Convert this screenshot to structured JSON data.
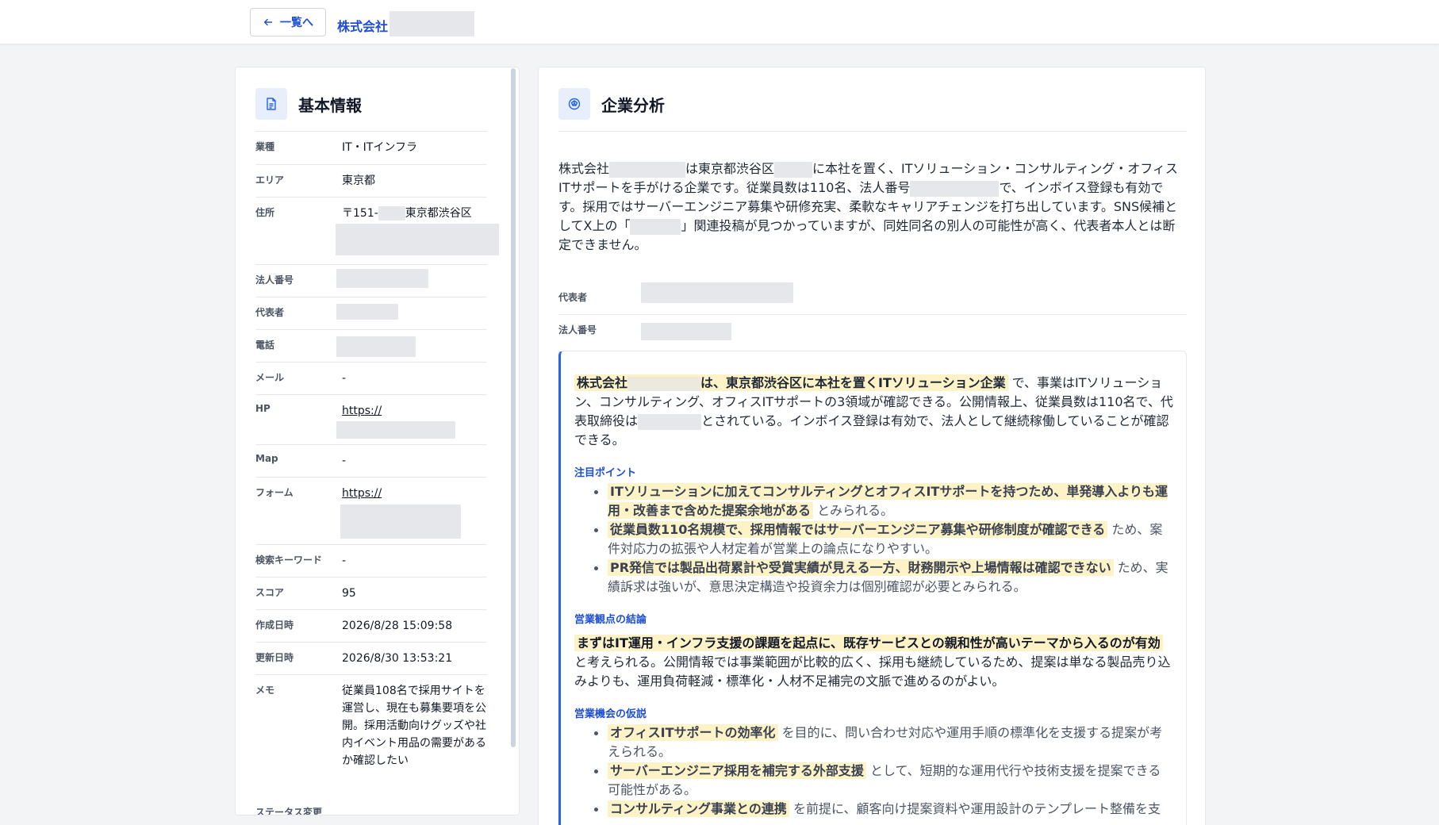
{
  "header": {
    "back_label": "一覧へ",
    "company_title": "株式会社"
  },
  "left": {
    "title": "基本情報",
    "rows": [
      {
        "label": "業種",
        "value": "IT・ITインフラ"
      },
      {
        "label": "エリア",
        "value": "東京都"
      },
      {
        "label": "住所",
        "value_prefix": "〒151-",
        "value_suffix": "東京都渋谷区"
      },
      {
        "label": "法人番号"
      },
      {
        "label": "代表者"
      },
      {
        "label": "電話"
      },
      {
        "label": "メール",
        "value": "-"
      },
      {
        "label": "HP",
        "value": "https://"
      },
      {
        "label": "Map",
        "value": "-"
      },
      {
        "label": "フォーム",
        "value": "https://"
      },
      {
        "label": "検索キーワード",
        "value": "-"
      },
      {
        "label": "スコア",
        "value": "95"
      },
      {
        "label": "作成日時",
        "value": "2026/8/28 15:09:58"
      },
      {
        "label": "更新日時",
        "value": "2026/8/30 13:53:21"
      },
      {
        "label": "メモ",
        "value": "従業員108名で採用サイトを運営し、現在も募集要項を公開。採用活動向けグッズや社内イベント用品の需要があるか確認したい"
      },
      {
        "label": "ステータス変更"
      }
    ]
  },
  "right": {
    "title": "企業分析",
    "summary": {
      "p1": "株式会社",
      "p2": "は東京都渋谷区",
      "p3": "に本社を置く、ITソリューション・コンサルティング・オフィスITサポートを手がける企業です。従業員数は110名、法人番号",
      "p4": "で、インボイス登録も有効です。採用ではサーバーエンジニア募集や研修充実、柔軟なキャリアチェンジを打ち出しています。SNS候補としてX上の「",
      "p5": "」関連投稿が見つかっていますが、同姓同名の別人の可能性が高く、代表者本人とは断定できません。"
    },
    "meta": [
      {
        "label": "代表者"
      },
      {
        "label": "法人番号"
      }
    ],
    "analysis": {
      "intro_hl_a": "株式会社",
      "intro_hl_b": "は、東京都渋谷区に本社を置くITソリューション企業",
      "intro_rest_a": "で、事業はITソリューション、コンサルティング、オフィスITサポートの3領域が確認できる。公開情報上、従業員数は110名で、代表取締役は",
      "intro_rest_b": "とされている。インボイス登録は有効で、法人として継続稼働していることが確認できる。",
      "points_title": "注目ポイント",
      "points": [
        {
          "hl": "ITソリューションに加えてコンサルティングとオフィスITサポートを持つため、単発導入よりも運用・改善まで含めた提案余地がある",
          "rest": "とみられる。"
        },
        {
          "hl": "従業員数110名規模で、採用情報ではサーバーエンジニア募集や研修制度が確認できる",
          "rest": "ため、案件対応力の拡張や人材定着が営業上の論点になりやすい。"
        },
        {
          "hl": "PR発信では製品出荷累計や受賞実績が見える一方、財務開示や上場情報は確認できない",
          "rest": "ため、実績訴求は強いが、意思決定構造や投資余力は個別確認が必要とみられる。"
        }
      ],
      "conclusion_title": "営業観点の結論",
      "conclusion_hl": "まずはIT運用・インフラ支援の課題を起点に、既存サービスとの親和性が高いテーマから入るのが有効",
      "conclusion_rest": "と考えられる。公開情報では事業範囲が比較的広く、採用も継続しているため、提案は単なる製品売り込みよりも、運用負荷軽減・標準化・人材不足補完の文脈で進めるのがよい。",
      "chances_title": "営業機会の仮説",
      "chances": [
        {
          "hl": "オフィスITサポートの効率化",
          "rest": "を目的に、問い合わせ対応や運用手順の標準化を支援する提案が考えられる。"
        },
        {
          "hl": "サーバーエンジニア採用を補完する外部支援",
          "rest": "として、短期的な運用代行や技術支援を提案できる可能性がある。"
        },
        {
          "hl": "コンサルティング事業との連携",
          "rest": "を前提に、顧客向け提案資料や運用設計のテンプレート整備を支"
        }
      ]
    }
  },
  "colors": {
    "accent": "#1d4ed8",
    "highlight": "#fef3c7",
    "redaction": "#e5e7eb"
  },
  "icons": {
    "back": "arrow-left-icon",
    "basic_info": "document-icon",
    "analysis": "analysis-icon"
  }
}
